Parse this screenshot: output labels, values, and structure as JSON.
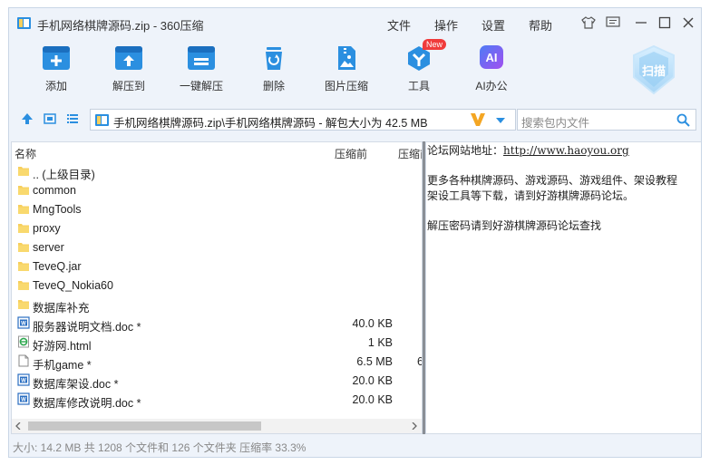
{
  "window": {
    "title": "手机网络棋牌源码.zip - 360压缩",
    "menus": [
      "文件",
      "操作",
      "设置",
      "帮助"
    ]
  },
  "toolbar": {
    "buttons": [
      {
        "label": "添加",
        "icon": "add-archive-icon"
      },
      {
        "label": "解压到",
        "icon": "extract-to-icon"
      },
      {
        "label": "一键解压",
        "icon": "one-click-extract-icon"
      },
      {
        "label": "删除",
        "icon": "trash-icon"
      },
      {
        "label": "图片压缩",
        "icon": "image-compress-icon"
      },
      {
        "label": "工具",
        "icon": "toolbox-icon",
        "badge": "New"
      },
      {
        "label": "AI办公",
        "icon": "ai-icon",
        "glyph": "AI"
      }
    ],
    "scan_label": "扫描"
  },
  "address": {
    "path": "手机网络棋牌源码.zip\\手机网络棋牌源码 - 解包大小为 42.5 MB"
  },
  "search": {
    "placeholder": "搜索包内文件"
  },
  "file_list": {
    "columns": [
      "名称",
      "压缩前",
      "压缩前"
    ],
    "rows": [
      {
        "name": ".. (上级目录)",
        "type": "folder",
        "size": "",
        "extra": ""
      },
      {
        "name": "common",
        "type": "folder",
        "size": "",
        "extra": ""
      },
      {
        "name": "MngTools",
        "type": "folder",
        "size": "",
        "extra": ""
      },
      {
        "name": "proxy",
        "type": "folder",
        "size": "",
        "extra": ""
      },
      {
        "name": "server",
        "type": "folder",
        "size": "",
        "extra": ""
      },
      {
        "name": "TeveQ.jar",
        "type": "folder",
        "size": "",
        "extra": ""
      },
      {
        "name": "TeveQ_Nokia60",
        "type": "folder",
        "size": "",
        "extra": ""
      },
      {
        "name": "数据库补充",
        "type": "folder",
        "size": "",
        "extra": ""
      },
      {
        "name": "服务器说明文档.doc *",
        "type": "doc",
        "size": "40.0 KB",
        "extra": ""
      },
      {
        "name": "好游网.html",
        "type": "html",
        "size": "1 KB",
        "extra": ""
      },
      {
        "name": "手机game *",
        "type": "file",
        "size": "6.5 MB",
        "extra": "6"
      },
      {
        "name": "数据库架设.doc *",
        "type": "doc",
        "size": "20.0 KB",
        "extra": ""
      },
      {
        "name": "数据库修改说明.doc *",
        "type": "doc",
        "size": "20.0 KB",
        "extra": ""
      }
    ]
  },
  "info": {
    "forum_label": "论坛网站地址：",
    "forum_url": "http://www.haoyou.org",
    "line2": "更多各种棋牌源码、游戏源码、游戏组件、架设教程",
    "line3": "架设工具等下载，请到好游棋牌源码论坛。",
    "line4": "解压密码请到好游棋牌源码论坛查找"
  },
  "status": {
    "text": "大小: 14.2 MB 共 1208 个文件和 126 个文件夹 压缩率 33.3%"
  },
  "colors": {
    "accent": "#2b8fe0",
    "folder": "#f7cf5c",
    "new_badge": "#f03b3b",
    "ai_tile": "#7c5cf0",
    "v_logo": "#f4a623"
  }
}
